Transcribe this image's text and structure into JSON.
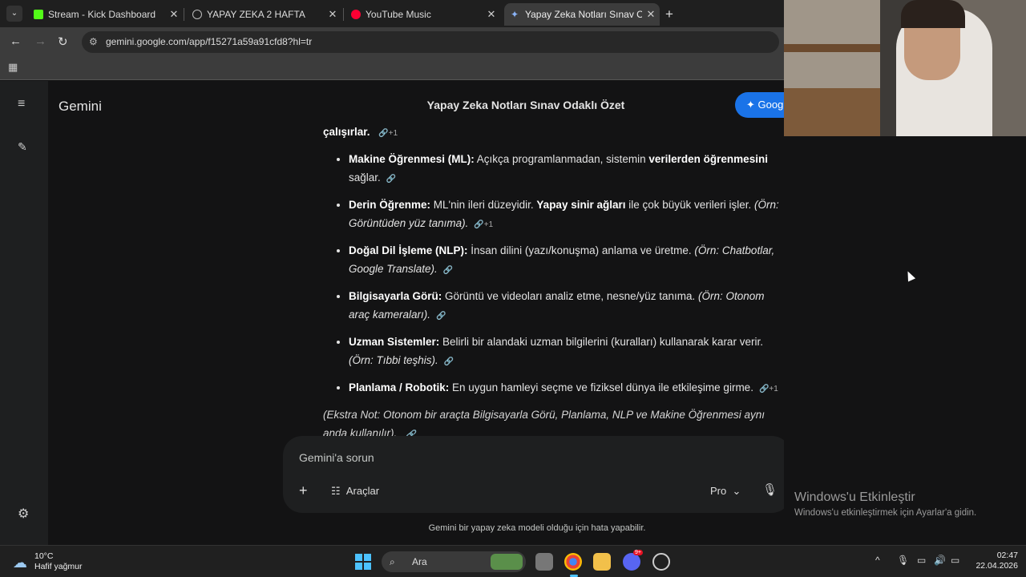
{
  "browser": {
    "tabs": [
      {
        "title": "Stream - Kick Dashboard",
        "icon": "kick-icon",
        "color": "#53fc18"
      },
      {
        "title": "YAPAY ZEKA 2 HAFTA",
        "icon": "globe-icon",
        "color": "#bbbbbb"
      },
      {
        "title": "YouTube Music",
        "icon": "youtube-music-icon",
        "color": "#ff0033"
      },
      {
        "title": "Yapay Zeka Notları Sınav Odaklı",
        "icon": "gemini-icon",
        "color": "#8ab4f8",
        "active": true
      }
    ],
    "url": "gemini.google.com/app/f15271a59a91cfd8?hl=tr"
  },
  "gemini": {
    "brand": "Gemini",
    "chat_title": "Yapay Zeka Notları Sınav Odaklı Özet",
    "google_button": "Goog",
    "lead_text": "çalışırlar.",
    "lead_extra": "+1",
    "items": [
      {
        "term": "Makine Öğrenmesi (ML):",
        "text": " Açıkça programlanmadan, sistemin ",
        "bold2": "verilerden öğrenmesini",
        "text2": " sağlar.",
        "example": "",
        "extra": ""
      },
      {
        "term": "Derin Öğrenme:",
        "text": " ML'nin ileri düzeyidir. ",
        "bold2": "Yapay sinir ağları",
        "text2": " ile çok büyük verileri işler. ",
        "example": "(Örn: Görüntüden yüz tanıma).",
        "extra": "+1"
      },
      {
        "term": "Doğal Dil İşleme (NLP):",
        "text": " İnsan dilini (yazı/konuşma) anlama ve üretme. ",
        "bold2": "",
        "text2": "",
        "example": "(Örn: Chatbotlar, Google Translate).",
        "extra": ""
      },
      {
        "term": "Bilgisayarla Görü:",
        "text": " Görüntü ve videoları analiz etme, nesne/yüz tanıma. ",
        "bold2": "",
        "text2": "",
        "example": "(Örn: Otonom araç kameraları).",
        "extra": ""
      },
      {
        "term": "Uzman Sistemler:",
        "text": " Belirli bir alandaki uzman bilgilerini (kuralları) kullanarak karar verir. ",
        "bold2": "",
        "text2": "",
        "example": "(Örn: Tıbbi teşhis).",
        "extra": ""
      },
      {
        "term": "Planlama / Robotik:",
        "text": " En uygun hamleyi seçme ve fiziksel dünya ile etkileşime girme.",
        "bold2": "",
        "text2": "",
        "example": "",
        "extra": "+1"
      }
    ],
    "note": "(Ekstra Not: Otonom bir araçta Bilgisayarla Görü, Planlama, NLP ve Makine Öğrenmesi aynı anda kullanılır).",
    "input_placeholder": "Gemini'a sorun",
    "tools_label": "Araçlar",
    "model_label": "Pro",
    "disclaimer": "Gemini bir yapay zeka modeli olduğu için hata yapabilir."
  },
  "windows": {
    "activate_title": "Windows'u Etkinleştir",
    "activate_sub": "Windows'u etkinleştirmek için Ayarlar'a gidin.",
    "weather_temp": "10°C",
    "weather_desc": "Hafif yağmur",
    "search_label": "Ara",
    "time": "02:47",
    "date": "22.04.2026",
    "discord_badge": "9+"
  }
}
